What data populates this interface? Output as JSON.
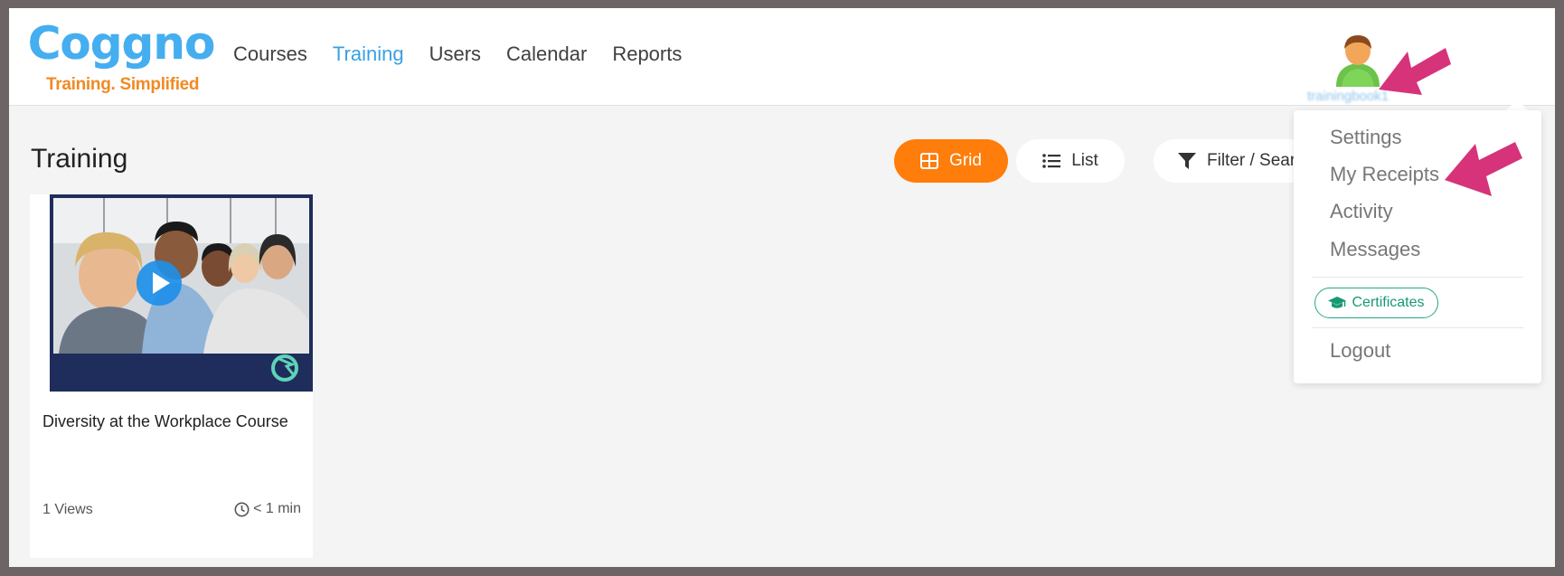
{
  "brand": {
    "name": "Coggno",
    "tagline": "Training. Simplified"
  },
  "nav": {
    "items": [
      {
        "label": "Courses",
        "active": false
      },
      {
        "label": "Training",
        "active": true
      },
      {
        "label": "Users",
        "active": false
      },
      {
        "label": "Calendar",
        "active": false
      },
      {
        "label": "Reports",
        "active": false
      }
    ]
  },
  "user": {
    "name": "trainingbook1",
    "avatar_icon": "user-avatar-icon"
  },
  "page": {
    "title": "Training"
  },
  "view_toggle": {
    "grid_label": "Grid",
    "list_label": "List",
    "filter_label": "Filter / Search"
  },
  "courses": [
    {
      "title": "Diversity at the Workplace Course",
      "views": "1 Views",
      "duration": "< 1 min"
    }
  ],
  "user_menu": {
    "settings": "Settings",
    "receipts": "My Receipts",
    "activity": "Activity",
    "messages": "Messages",
    "certificates": "Certificates",
    "logout": "Logout"
  },
  "colors": {
    "accent_orange": "#ff7d0a",
    "active_blue": "#3aa0e0",
    "cert_green": "#159a76",
    "annotation_pink": "#d6337a"
  }
}
